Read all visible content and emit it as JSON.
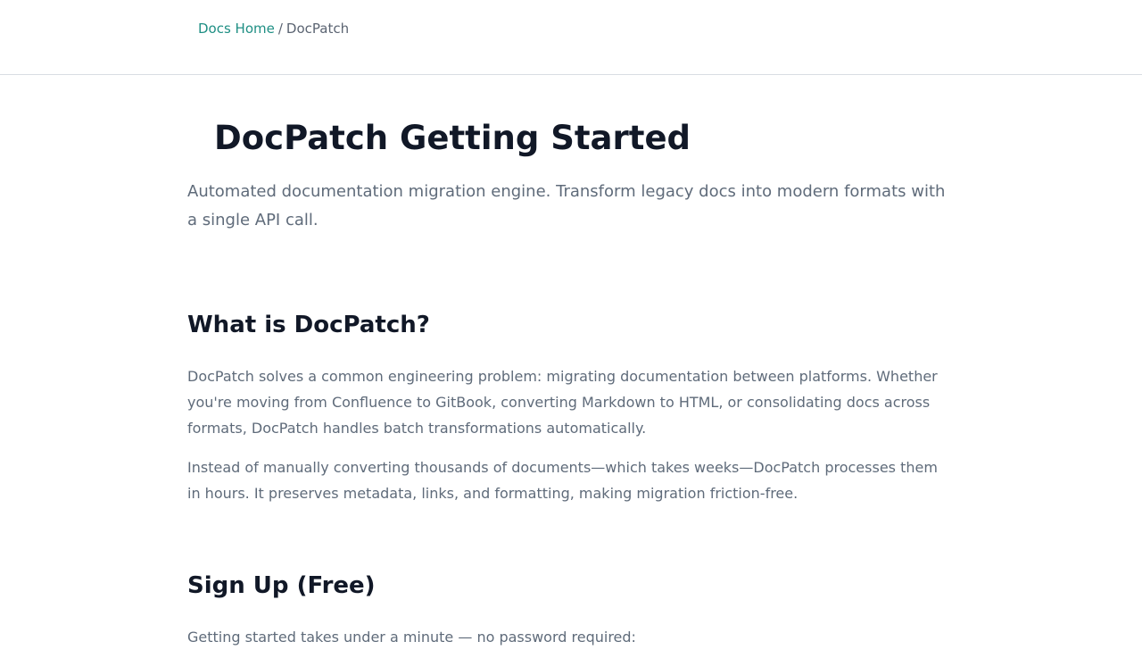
{
  "breadcrumb": {
    "home_label": "Docs Home",
    "separator": "/",
    "current_label": "DocPatch"
  },
  "page": {
    "title": "DocPatch Getting Started",
    "subtitle": "Automated documentation migration engine. Transform legacy docs into modern formats with a single API call."
  },
  "sections": {
    "what": {
      "heading": "What is DocPatch?",
      "paragraph_1": "DocPatch solves a common engineering problem: migrating documentation between platforms. Whether you're moving from Confluence to GitBook, converting Markdown to HTML, or consolidating docs across formats, DocPatch handles batch transformations automatically.",
      "paragraph_2": "Instead of manually converting thousands of documents—which takes weeks—DocPatch processes them in hours. It preserves metadata, links, and formatting, making migration friction-free."
    },
    "signup": {
      "heading": "Sign Up (Free)",
      "paragraph_1": "Getting started takes under a minute — no password required:"
    }
  },
  "colors": {
    "link": "#1f8f84",
    "heading": "#111827",
    "body_text": "#5f6b7a",
    "divider": "#d9dde3"
  }
}
